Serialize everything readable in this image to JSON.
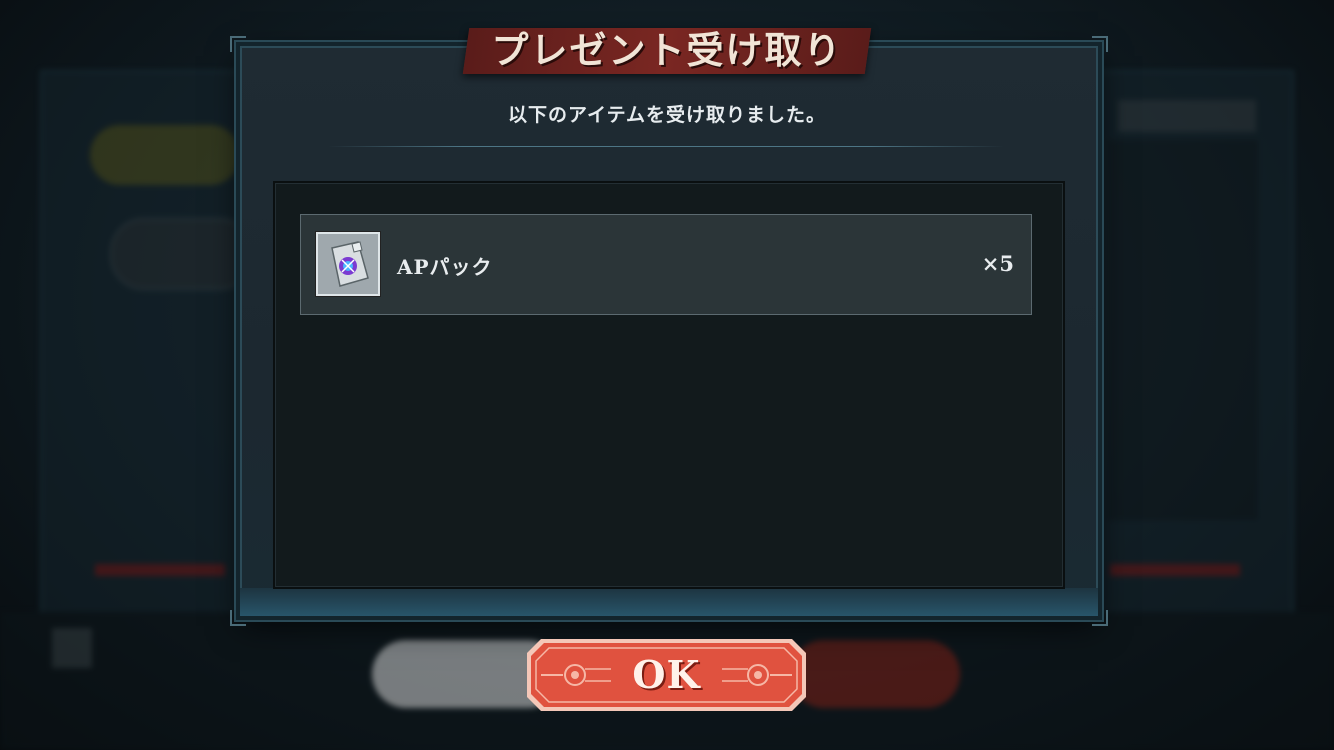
{
  "dialog": {
    "title": "プレゼント受け取り",
    "message": "以下のアイテムを受け取りました。"
  },
  "items": [
    {
      "name": "APパック",
      "quantity": "×5",
      "icon": "ap-pack-icon"
    }
  ],
  "ok_button": {
    "label": "OK"
  },
  "colors": {
    "banner": "#7a2722",
    "ok_button": "#e55a4a",
    "frame": "#2c4b58"
  }
}
